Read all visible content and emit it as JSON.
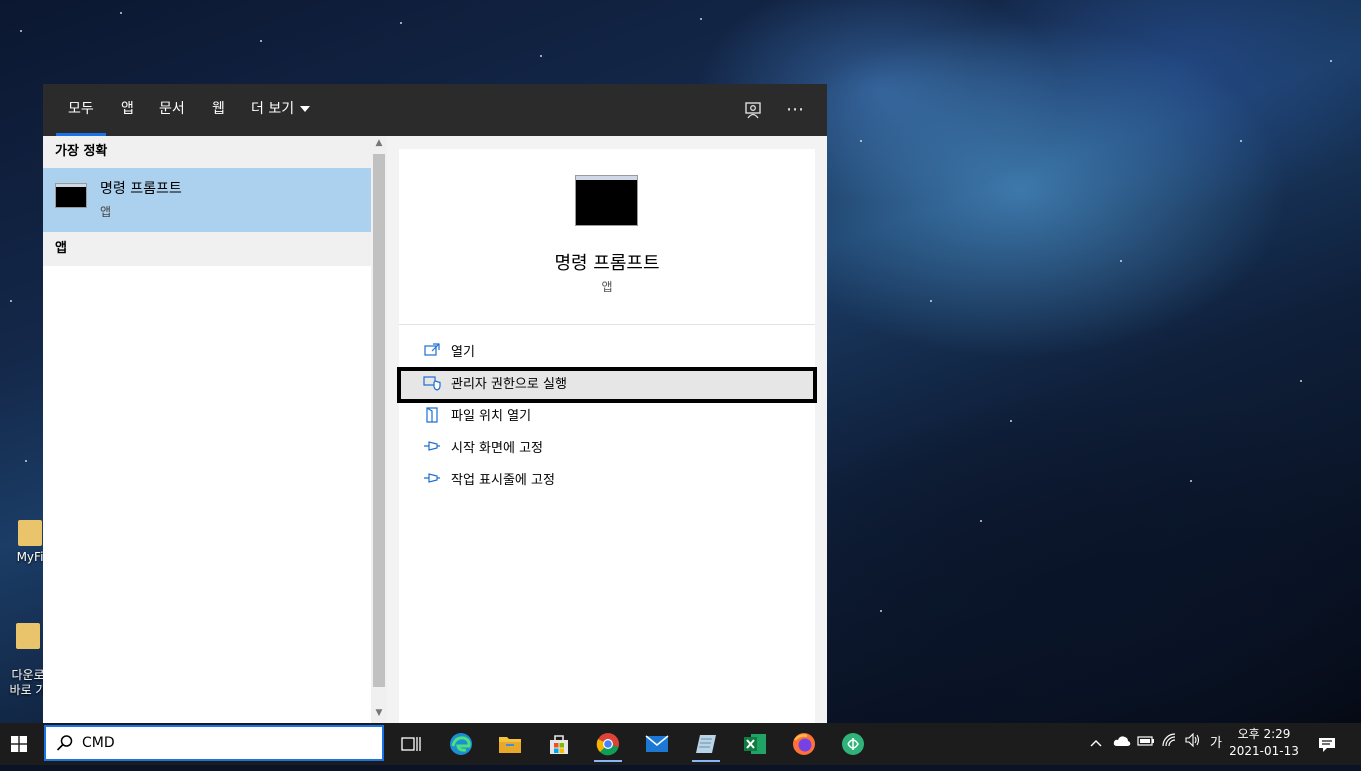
{
  "search_panel": {
    "tabs": [
      {
        "label": "모두",
        "active": true
      },
      {
        "label": "앱"
      },
      {
        "label": "문서"
      },
      {
        "label": "웹"
      },
      {
        "label": "더 보기"
      }
    ],
    "header_icons": [
      "feedback-icon",
      "more-options-icon"
    ],
    "results": {
      "best_match_heading": "가장 정확",
      "best_match": {
        "title": "명령 프롬프트",
        "subtitle": "앱",
        "icon": "command-prompt-icon"
      },
      "apps_heading": "앱"
    },
    "detail": {
      "title": "명령 프롬프트",
      "subtitle": "앱",
      "actions": [
        {
          "label": "열기",
          "icon": "open-icon"
        },
        {
          "label": "관리자 권한으로 실행",
          "icon": "run-as-admin-icon",
          "highlighted": true
        },
        {
          "label": "파일 위치 열기",
          "icon": "file-location-icon"
        },
        {
          "label": "시작 화면에 고정",
          "icon": "pin-icon"
        },
        {
          "label": "작업 표시줄에 고정",
          "icon": "pin-icon"
        }
      ]
    }
  },
  "desktop": {
    "icons": [
      {
        "label": "MyFi"
      },
      {
        "label": "다운로\n바로 가"
      }
    ]
  },
  "taskbar": {
    "search": {
      "value": "CMD"
    },
    "apps": [
      "task-view-icon",
      "edge-icon",
      "file-explorer-icon",
      "store-icon",
      "chrome-icon",
      "mail-icon",
      "notepad-icon",
      "excel-icon",
      "firefox-icon",
      "other-app-icon"
    ],
    "tray": {
      "ime_label": "가",
      "time": "오후 2:29",
      "date": "2021-01-13"
    }
  },
  "colors": {
    "accent": "#1a73e8",
    "selected_result": "#abd1ee",
    "header": "#2b2b2b",
    "taskbar": "#1c1c1c"
  }
}
